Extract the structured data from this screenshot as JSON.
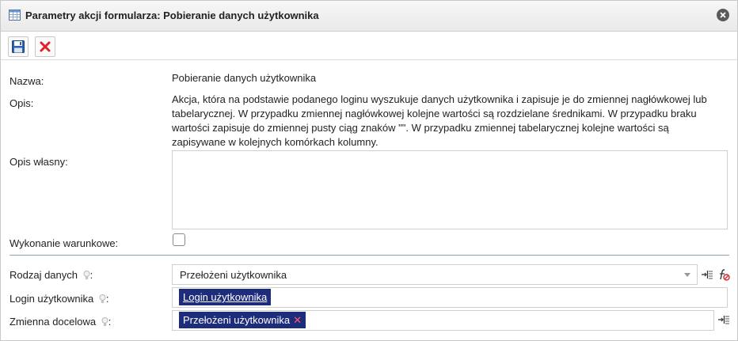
{
  "window": {
    "title": "Parametry akcji formularza: Pobieranie danych użytkownika",
    "title_icon": "table-icon",
    "close_icon": "close-icon"
  },
  "toolbar": {
    "save_icon": "floppy-save-icon",
    "cancel_icon": "red-x-icon"
  },
  "form": {
    "name_label": "Nazwa:",
    "name_value": "Pobieranie danych użytkownika",
    "description_label": "Opis:",
    "description_value": "Akcja, która na podstawie podanego loginu wyszukuje danych użytkownika i zapisuje je do zmiennej nagłówkowej lub tabelarycznej. W przypadku zmiennej nagłówkowej kolejne wartości są rozdzielane średnikami. W przypadku braku wartości zapisuje do zmiennej pusty ciąg znaków \"\". W przypadku zmiennej tabelarycznej kolejne wartości są zapisywane w kolejnych komórkach kolumny.",
    "own_description_label": "Opis własny:",
    "own_description_value": "",
    "conditional_label": "Wykonanie warunkowe:",
    "conditional_checked": false,
    "data_type_label": "Rodzaj danych",
    "data_type_value": "Przełożeni użytkownika",
    "login_label": "Login użytkownika",
    "login_chip": "Login użytkownika",
    "target_label": "Zmienna docelowa",
    "target_chip": "Przełożeni użytkownika",
    "colon": ":"
  },
  "colors": {
    "chip_background": "#1e2c7c",
    "chip_remove": "#ff5a6a",
    "cancel_red": "#e0202a",
    "save_blue": "#2a62b0"
  }
}
